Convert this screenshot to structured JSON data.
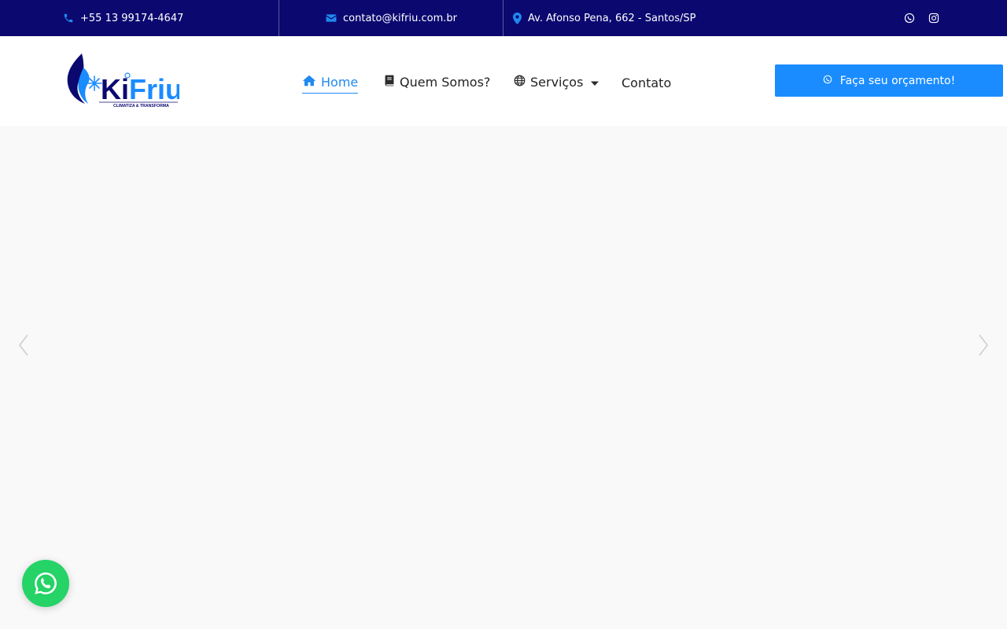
{
  "topbar": {
    "phone": "+55 13 99174-4647",
    "email": "contato@kifriu.com.br",
    "address": "Av. Afonso Pena, 662 - Santos/SP"
  },
  "brand": {
    "name_part1": "Ki",
    "name_part2": "Friu",
    "tagline": "CLIMATIZA & TRANSFORMA"
  },
  "nav": {
    "items": [
      {
        "label": "Home",
        "icon": "home-icon"
      },
      {
        "label": "Quem Somos?",
        "icon": "book-icon"
      },
      {
        "label": "Serviços",
        "icon": "globe-icon"
      },
      {
        "label": "Contato",
        "icon": ""
      }
    ]
  },
  "cta": {
    "label": "Faça seu orçamento!",
    "icon": "whatsapp-icon"
  },
  "colors": {
    "topbar_bg": "#0b0870",
    "accent": "#1a8cff",
    "whatsapp": "#25d366"
  }
}
